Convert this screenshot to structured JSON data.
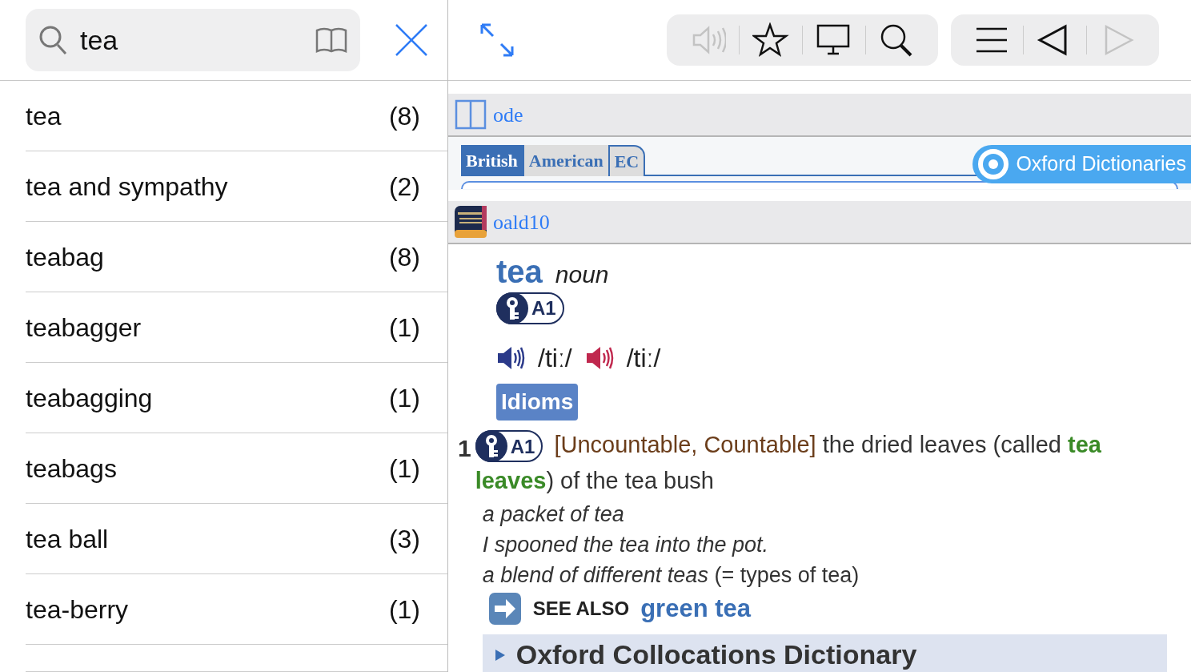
{
  "search": {
    "value": "tea"
  },
  "results": [
    {
      "word": "tea",
      "count": "(8)"
    },
    {
      "word": "tea and sympathy",
      "count": "(2)"
    },
    {
      "word": "teabag",
      "count": "(8)"
    },
    {
      "word": "teabagger",
      "count": "(1)"
    },
    {
      "word": "teabagging",
      "count": "(1)"
    },
    {
      "word": "teabags",
      "count": "(1)"
    },
    {
      "word": "tea ball",
      "count": "(3)"
    },
    {
      "word": "tea-berry",
      "count": "(1)"
    }
  ],
  "toolbar_groups": [
    [
      {
        "kind": "speaker",
        "disabled": true
      },
      {
        "kind": "star",
        "disabled": false
      },
      {
        "kind": "monitor",
        "disabled": false
      },
      {
        "kind": "search",
        "disabled": false
      }
    ],
    [
      {
        "kind": "list",
        "disabled": false
      },
      {
        "kind": "back",
        "disabled": false
      },
      {
        "kind": "forward",
        "disabled": true
      }
    ]
  ],
  "dictionaries": [
    {
      "kind": "ode",
      "name": "ode",
      "tabs": [
        {
          "label": "British",
          "selected": true
        },
        {
          "label": "American",
          "selected": false
        },
        {
          "label": "EC",
          "selected": false
        }
      ],
      "logo_text": "Oxford Dictionaries"
    },
    {
      "kind": "oald",
      "name": "oald10"
    }
  ],
  "entry": {
    "headword": "tea",
    "pos": "noun",
    "level": "A1",
    "pronunciations": [
      {
        "kind": "british",
        "text": "/tiː/"
      },
      {
        "kind": "american",
        "text": "/tiː/"
      }
    ],
    "idioms_button": "Idioms",
    "senses": [
      {
        "number": "1",
        "level": "A1",
        "definition": [
          {
            "kind": "grammar",
            "text": "[Uncountable, Countable]"
          },
          {
            "kind": "text",
            "text": " the dried leaves (called "
          },
          {
            "kind": "term",
            "text": "tea leaves"
          },
          {
            "kind": "text",
            "text": ") of the tea bush"
          }
        ],
        "examples": [
          {
            "text": "a packet of tea"
          },
          {
            "text": "I spooned the tea into the pot."
          },
          {
            "text": "a blend of different teas",
            "gloss": "(= types of tea)"
          }
        ],
        "see_also": {
          "label": "SEE ALSO",
          "link": "green tea"
        }
      }
    ],
    "collocations": "Oxford Collocations Dictionary"
  }
}
